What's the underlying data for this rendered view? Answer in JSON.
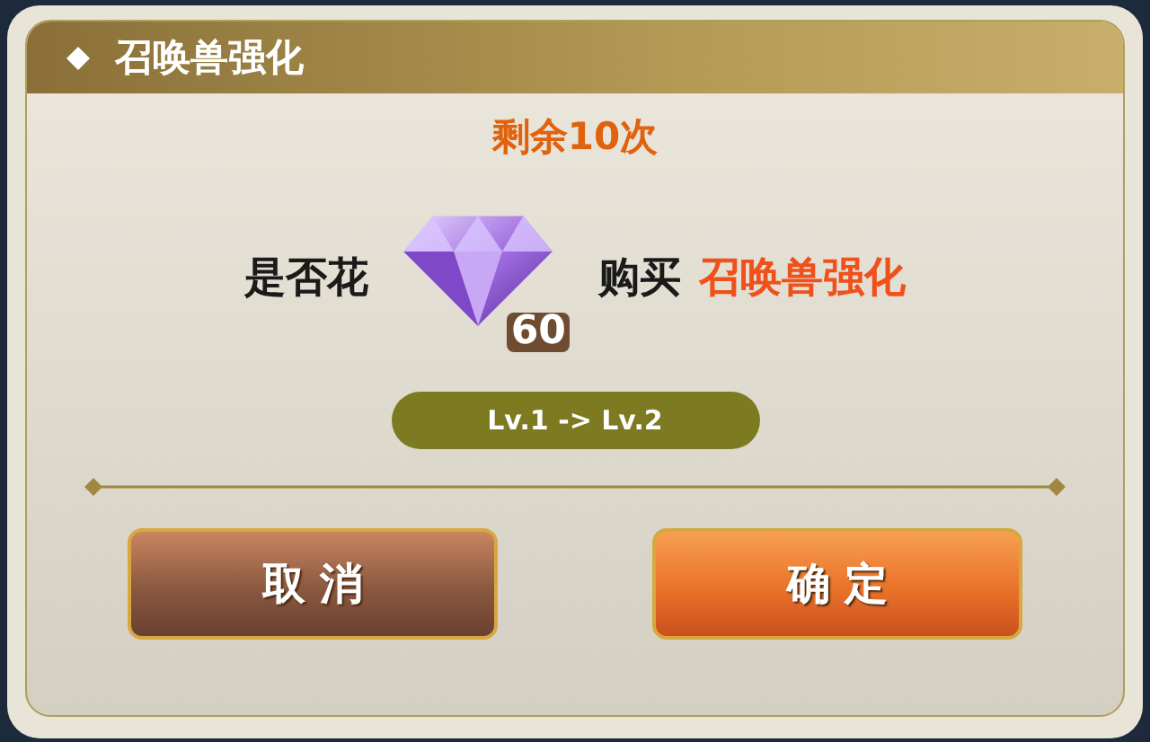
{
  "dialog": {
    "title": "召唤兽强化",
    "remaining": "剩余10次",
    "prompt": {
      "before": "是否花",
      "cost": "60",
      "after": "购买",
      "item": "召唤兽强化"
    },
    "level_change": "Lv.1 -> Lv.2",
    "buttons": [
      {
        "label": "取 消",
        "kind": "cancel"
      },
      {
        "label": "确 定",
        "kind": "confirm"
      }
    ]
  }
}
